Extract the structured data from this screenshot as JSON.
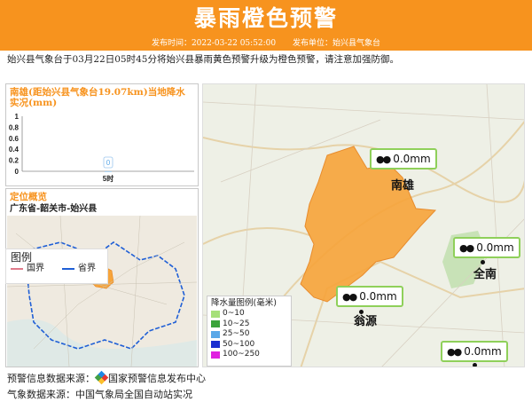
{
  "header": {
    "title": "暴雨橙色预警",
    "publish_time_label": "发布时间：2022-03-22 05:52:00",
    "publisher_label": "发布单位：始兴县气象台"
  },
  "summary": "始兴县气象台于03月22日05时45分将始兴县暴雨黄色预警升级为橙色预警，请注意加强防御。",
  "rain_panel": {
    "title": "南雄(距始兴县气象台19.07km)当地降水实况(mm)"
  },
  "chart_data": {
    "type": "bar",
    "categories": [
      "5时"
    ],
    "values": [
      0
    ],
    "data_labels": [
      "0"
    ],
    "y_ticks": [
      "1",
      "0.8",
      "0.6",
      "0.4",
      "0.2",
      "0"
    ],
    "ylim": [
      0,
      1
    ]
  },
  "location_panel": {
    "title": "定位概览",
    "region": "广东省-韶关市-始兴县"
  },
  "mini_legend": {
    "title": "图例",
    "items": [
      {
        "label": "国界",
        "color": "#e07a8a"
      },
      {
        "label": "省界",
        "color": "#1f5fd6"
      }
    ]
  },
  "stations": [
    {
      "value": "0.0mm",
      "city": "南雄"
    },
    {
      "value": "0.0mm",
      "city": "全南"
    },
    {
      "value": "0.0mm",
      "city": "翁源"
    },
    {
      "value": "0.0mm",
      "city": ""
    }
  ],
  "rain_legend": {
    "title": "降水量图例(毫米)",
    "items": [
      {
        "label": "0~10",
        "color": "#a6e07a"
      },
      {
        "label": "10~25",
        "color": "#3aa33a"
      },
      {
        "label": "25~50",
        "color": "#5aa8e8"
      },
      {
        "label": "50~100",
        "color": "#1a2fd0"
      },
      {
        "label": "100~250",
        "color": "#e020e0"
      }
    ]
  },
  "footer": {
    "warning_source_label": "预警信息数据来源：",
    "warning_source_value": "国家预警信息发布中心",
    "weather_source": "气象数据来源：中国气象局全国自动站实况"
  },
  "colors": {
    "brand": "#f7931e",
    "warning_area": "#f7a43a",
    "station_border": "#8fd05a"
  }
}
